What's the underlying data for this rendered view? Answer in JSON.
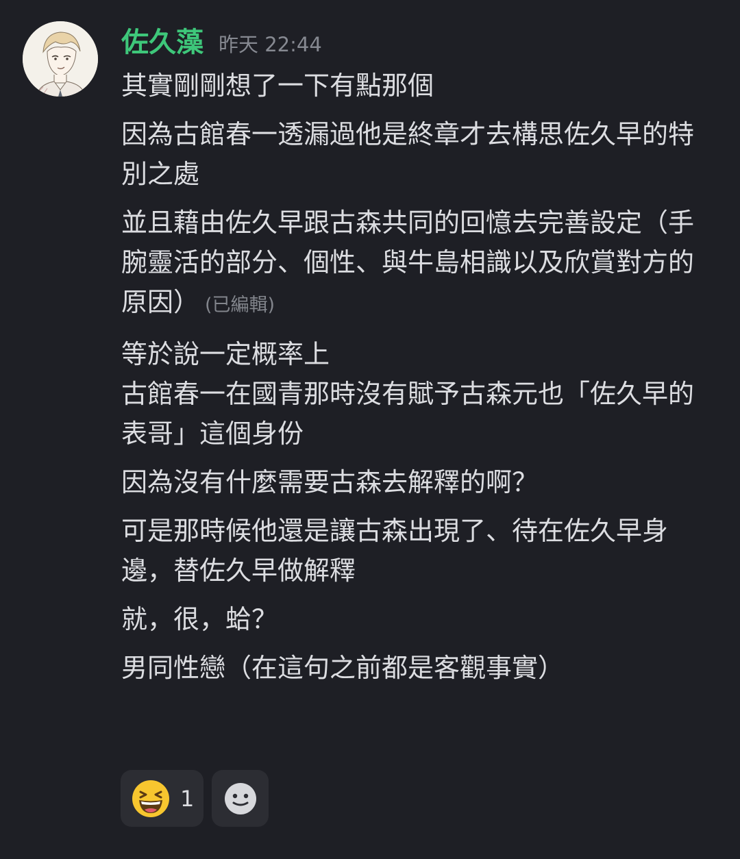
{
  "message": {
    "author": "佐久藻",
    "timestamp": "昨天 22:44",
    "avatar_icon": "anime-character-avatar",
    "author_color": "#3ec77a",
    "lines": [
      {
        "text": "其實剛剛想了一下有點那個"
      },
      {
        "text": "因為古館春一透漏過他是終章才去構思佐久早的特別之處"
      },
      {
        "text": "並且藉由佐久早跟古森共同的回憶去完善設定（手腕靈活的部分、個性、與牛島相識以及欣賞對方的原因）",
        "edited": "(已編輯)"
      },
      {
        "text": "等於說一定概率上"
      },
      {
        "text": "古館春一在國青那時沒有賦予古森元也「佐久早的表哥」這個身份"
      },
      {
        "text": "因為沒有什麼需要古森去解釋的啊？"
      },
      {
        "text": "可是那時候他還是讓古森出現了、待在佐久早身邊，替佐久早做解釋"
      },
      {
        "text": "就，很，蛤？"
      },
      {
        "text": "男同性戀（在這句之前都是客觀事實）"
      }
    ]
  },
  "reactions": [
    {
      "icon": "grinning-squinting-face-emoji",
      "count": "1"
    },
    {
      "icon": "add-reaction-smiley-icon"
    }
  ]
}
